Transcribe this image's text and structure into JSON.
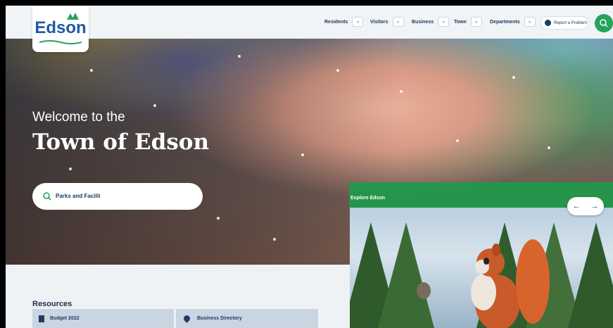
{
  "logo": {
    "text": "Edson"
  },
  "nav": [
    {
      "label": "Residents"
    },
    {
      "label": "Visitors"
    },
    {
      "label": "Business"
    },
    {
      "label": "Town"
    },
    {
      "label": "Departments"
    }
  ],
  "header": {
    "report_label": "Report a Problem"
  },
  "hero": {
    "welcome_small": "Welcome to the",
    "welcome_big": "Town of Edson",
    "search_value": "Parks and Facilit"
  },
  "explore": {
    "label": "Explore Edson",
    "prev": "←",
    "next": "→"
  },
  "resources": {
    "title": "Resources",
    "items": [
      {
        "label": "Budget 2022",
        "icon": "document-icon"
      },
      {
        "label": "Business Directory",
        "icon": "map-pin-icon"
      }
    ]
  },
  "colors": {
    "brand_blue": "#1e5aa8",
    "brand_green": "#25a35a",
    "nav_text": "#1c3c64"
  }
}
